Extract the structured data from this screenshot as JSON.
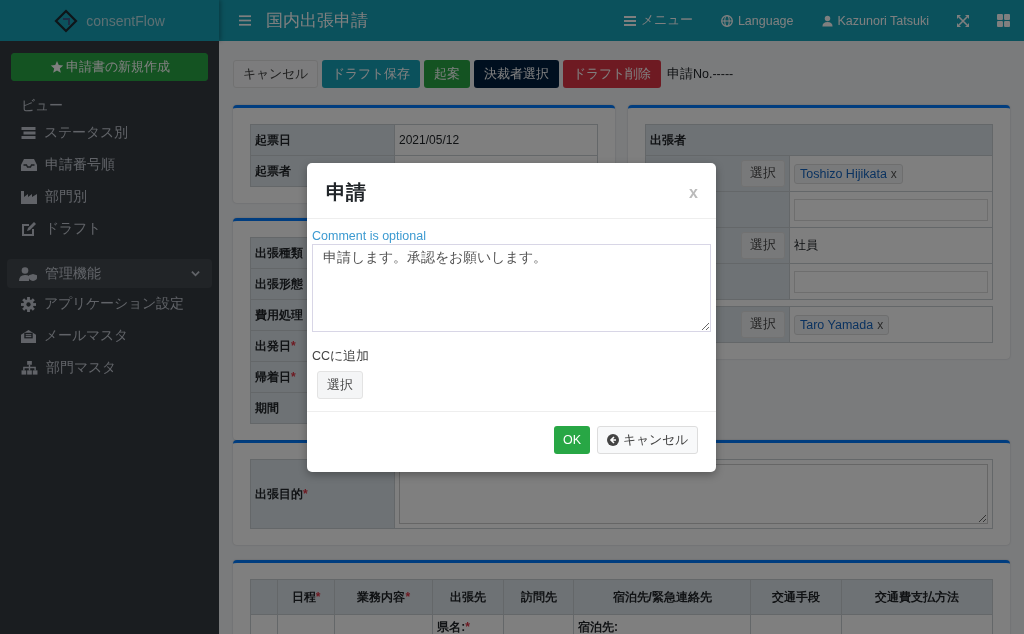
{
  "brand": {
    "name": "consentFlow"
  },
  "header": {
    "title": "国内出張申請",
    "menu": [
      {
        "kind": "menu",
        "label": "メニュー"
      },
      {
        "kind": "globe",
        "label": "Language"
      },
      {
        "kind": "user",
        "label": "Kazunori Tatsuki"
      },
      {
        "kind": "expand"
      },
      {
        "kind": "grid"
      }
    ]
  },
  "sidebar": {
    "new_button": "申請書の新規作成",
    "section": "ビュー",
    "items": [
      {
        "label": "ステータス別"
      },
      {
        "label": "申請番号順"
      },
      {
        "label": "部門別"
      },
      {
        "label": "ドラフト"
      }
    ],
    "admin": {
      "label": "管理機能",
      "expanded": true,
      "children": [
        {
          "label": "アプリケーション設定"
        },
        {
          "label": "メールマスタ"
        },
        {
          "label": "部門マスタ"
        }
      ]
    }
  },
  "toolbar": {
    "buttons": [
      {
        "kind": "light",
        "label": "キャンセル"
      },
      {
        "kind": "info",
        "label": "ドラフト保存"
      },
      {
        "kind": "success",
        "label": "起案"
      },
      {
        "kind": "navy",
        "label": "決裁者選択"
      },
      {
        "kind": "danger",
        "label": "ドラフト削除"
      }
    ],
    "application_no": "申請No.-----"
  },
  "info_card": {
    "rows": [
      {
        "label": "起票日",
        "value": "2021/05/12"
      },
      {
        "label": "起票者"
      }
    ]
  },
  "travel_card": {
    "rows": [
      {
        "label": "出張種類"
      },
      {
        "label": "出張形態"
      },
      {
        "label": "費用処理"
      },
      {
        "label": "出発日",
        "required": "*"
      },
      {
        "label": "帰着日",
        "required": "*"
      },
      {
        "label": "期間"
      }
    ]
  },
  "traveler_card": {
    "title": "出張者",
    "rows": [
      {
        "kind": "tag",
        "button": "選択",
        "tag": "Toshizo Hijikata",
        "remove": "x"
      },
      {
        "kind": "input"
      },
      {
        "kind": "text",
        "button": "選択",
        "value": "社員"
      },
      {
        "kind": "input"
      }
    ],
    "approver": {
      "button": "選択",
      "tag": "Taro Yamada",
      "remove": "x"
    }
  },
  "purpose_card": {
    "label": "出張目的",
    "required": "*"
  },
  "schedule_table": {
    "columns": [
      {
        "label": "日程",
        "required": "*"
      },
      {
        "label": "業務内容",
        "required": "*"
      },
      {
        "label": "出張先"
      },
      {
        "label": "訪問先"
      },
      {
        "label": "宿泊先/緊急連絡先"
      },
      {
        "label": "交通手段"
      },
      {
        "label": "交通費支払方法"
      }
    ],
    "row": {
      "destination": {
        "label": "県名:",
        "required": "*"
      },
      "lodging": {
        "label": "宿泊先:"
      }
    }
  },
  "dialog": {
    "title": "申請",
    "close": "x",
    "comment_label": "Comment is optional",
    "comment": "申請します。承認をお願いします。",
    "cc_label": "CCに追加",
    "cc_button": "選択",
    "ok": "OK",
    "cancel": "キャンセル"
  }
}
